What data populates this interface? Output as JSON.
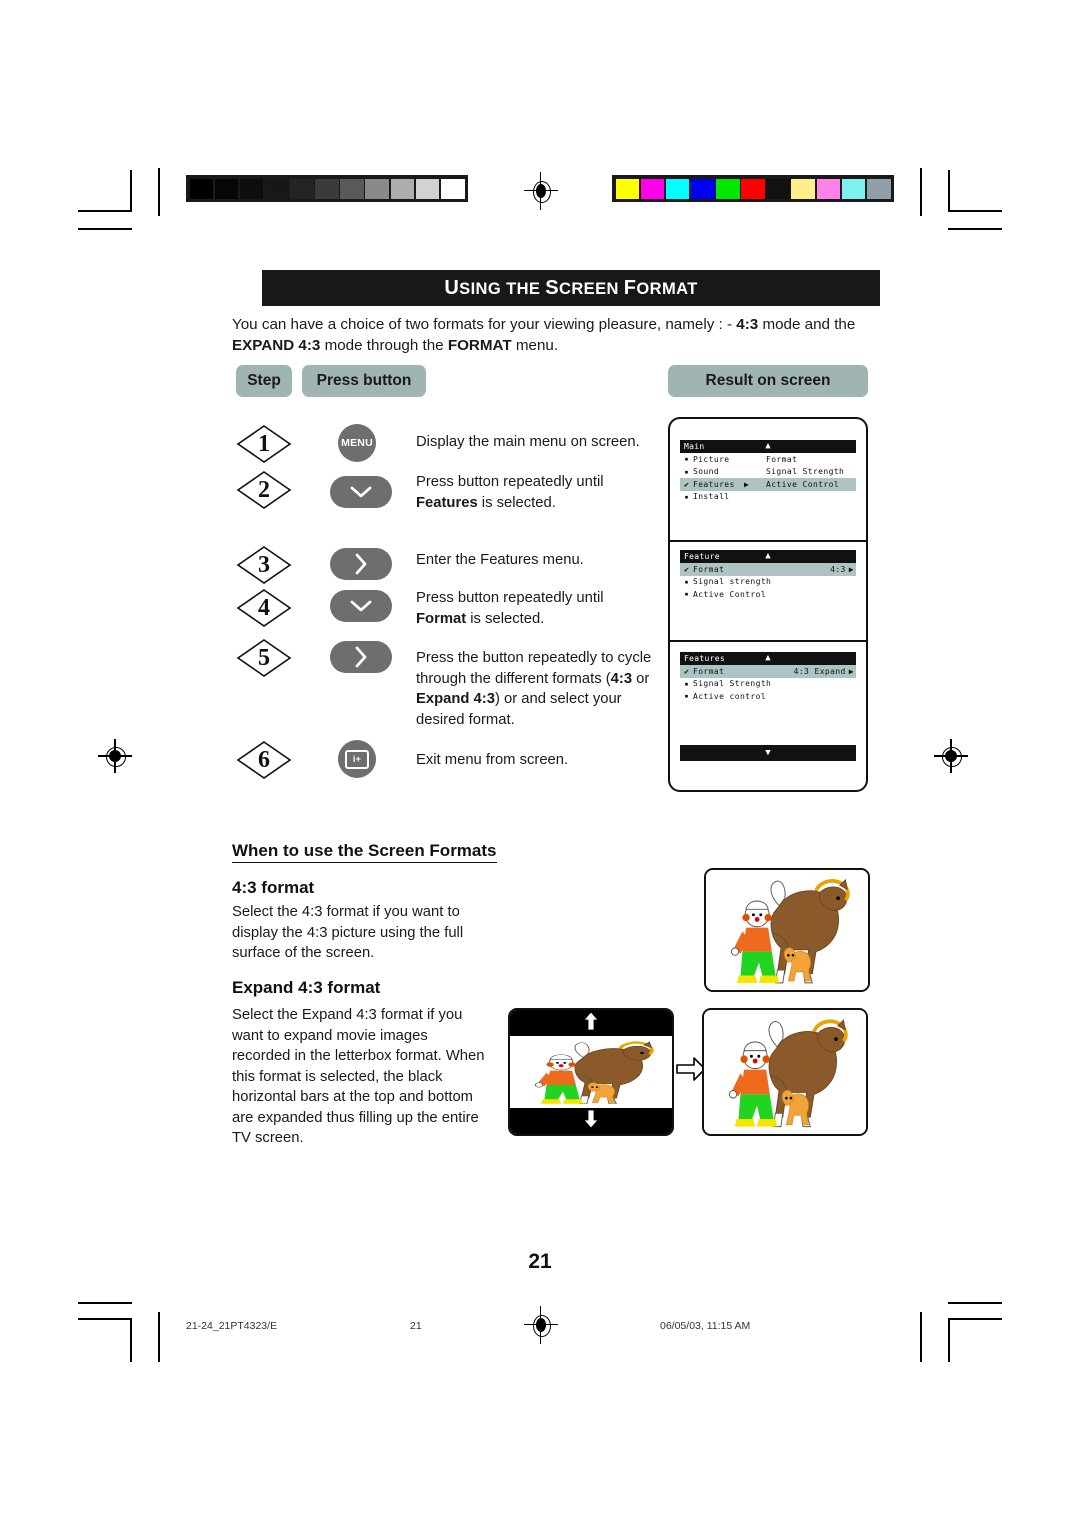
{
  "page": {
    "title_main": "USING THE SCREEN FORMAT",
    "title_parts": [
      "U",
      "SING THE ",
      "S",
      "CREEN ",
      "F",
      "ORMAT"
    ],
    "page_number": "21"
  },
  "intro": {
    "line1_a": "You can have a choice of two formats for your viewing pleasure, namely : - ",
    "line1_b": "4:3",
    "line1_c": " mode and the",
    "line2_a": "EXPAND 4:3",
    "line2_b": " mode through the ",
    "line2_c": "FORMAT",
    "line2_d": " menu."
  },
  "table_headers": {
    "step": "Step",
    "press_button": "Press button",
    "result": "Result on screen"
  },
  "steps": [
    {
      "number": "1",
      "button_label": "MENU",
      "button_type": "round-menu",
      "text": "Display the main menu on screen."
    },
    {
      "number": "2",
      "button_label": "",
      "button_type": "pill-down",
      "text_a": "Press button repeatedly until ",
      "text_b": "Features",
      "text_c": " is selected."
    },
    {
      "number": "3",
      "button_label": "",
      "button_type": "pill-right",
      "text": "Enter the Features menu."
    },
    {
      "number": "4",
      "button_label": "",
      "button_type": "pill-down",
      "text_a": "Press button repeatedly until ",
      "text_b": "Format",
      "text_c": " is selected."
    },
    {
      "number": "5",
      "button_label": "",
      "button_type": "pill-right",
      "text_a": "Press the button repeatedly to cycle through the different formats (",
      "text_b": "4:3",
      "text_c": " or ",
      "text_d": "Expand 4:3",
      "text_e": ") or and select your desired format."
    },
    {
      "number": "6",
      "button_label": "i+",
      "button_type": "round-info",
      "text": "Exit menu from screen."
    }
  ],
  "osd_menus": [
    {
      "title": "Main",
      "up_arrow": "▲",
      "rows": [
        {
          "mark": "▪",
          "label": "Picture",
          "col2": "Format",
          "highlight": false
        },
        {
          "mark": "▪",
          "label": "Sound",
          "col2": "Signal Strength",
          "highlight": false
        },
        {
          "mark": "✔",
          "label": "Features",
          "col2": "Active Control",
          "highlight": true,
          "arrow": "▶"
        },
        {
          "mark": "▪",
          "label": "Install",
          "col2": "",
          "highlight": false
        }
      ]
    },
    {
      "title": "Feature",
      "up_arrow": "▲",
      "rows": [
        {
          "mark": "✔",
          "label": "Format",
          "value": "4:3",
          "highlight": true,
          "arrow": "▶"
        },
        {
          "mark": "▪",
          "label": "Signal strength",
          "value": "",
          "highlight": false
        },
        {
          "mark": "▪",
          "label": "Active Control",
          "value": "",
          "highlight": false
        }
      ]
    },
    {
      "title": "Features",
      "up_arrow": "▲",
      "down_arrow": "▼",
      "rows": [
        {
          "mark": "✔",
          "label": "Format",
          "value": "4:3 Expand",
          "highlight": true,
          "arrow": "▶"
        },
        {
          "mark": "▪",
          "label": "Signal Strength",
          "value": "",
          "highlight": false
        },
        {
          "mark": "▪",
          "label": "Active control",
          "value": "",
          "highlight": false
        }
      ]
    }
  ],
  "sections": {
    "heading": "When to use the Screen Formats",
    "format43": {
      "heading": "4:3 format",
      "body": "Select the 4:3 format if you want to display the 4:3 picture using the full surface of the screen."
    },
    "expand43": {
      "heading": "Expand 4:3 format",
      "body": "Select the Expand 4:3 format if you want to expand movie images recorded in the letterbox format. When this format is selected, the black horizontal bars at the top and bottom are expanded thus filling up the entire TV screen."
    }
  },
  "footer": {
    "file_ref": "21-24_21PT4323/E",
    "page": "21",
    "timestamp": "06/05/03, 11:15 AM"
  },
  "colors": {
    "badge": "#a0b4b2",
    "button_gray": "#6e6e6e",
    "osd_highlight": "#aec4c4",
    "title_bar": "#181818"
  },
  "calibration": {
    "grayscale": [
      "#000000",
      "#060606",
      "#0d0d0d",
      "#171717",
      "#242424",
      "#3b3b3b",
      "#5a5a5a",
      "#8a8a8a",
      "#adadad",
      "#d2d2d2",
      "#ffffff"
    ],
    "color": [
      "#ffff00",
      "#ff00ec",
      "#00ffff",
      "#0000f0",
      "#00e800",
      "#ff0000",
      "#111111",
      "#fdf08a",
      "#ff82e8",
      "#7ff0f0",
      "#8fa0a8"
    ]
  }
}
